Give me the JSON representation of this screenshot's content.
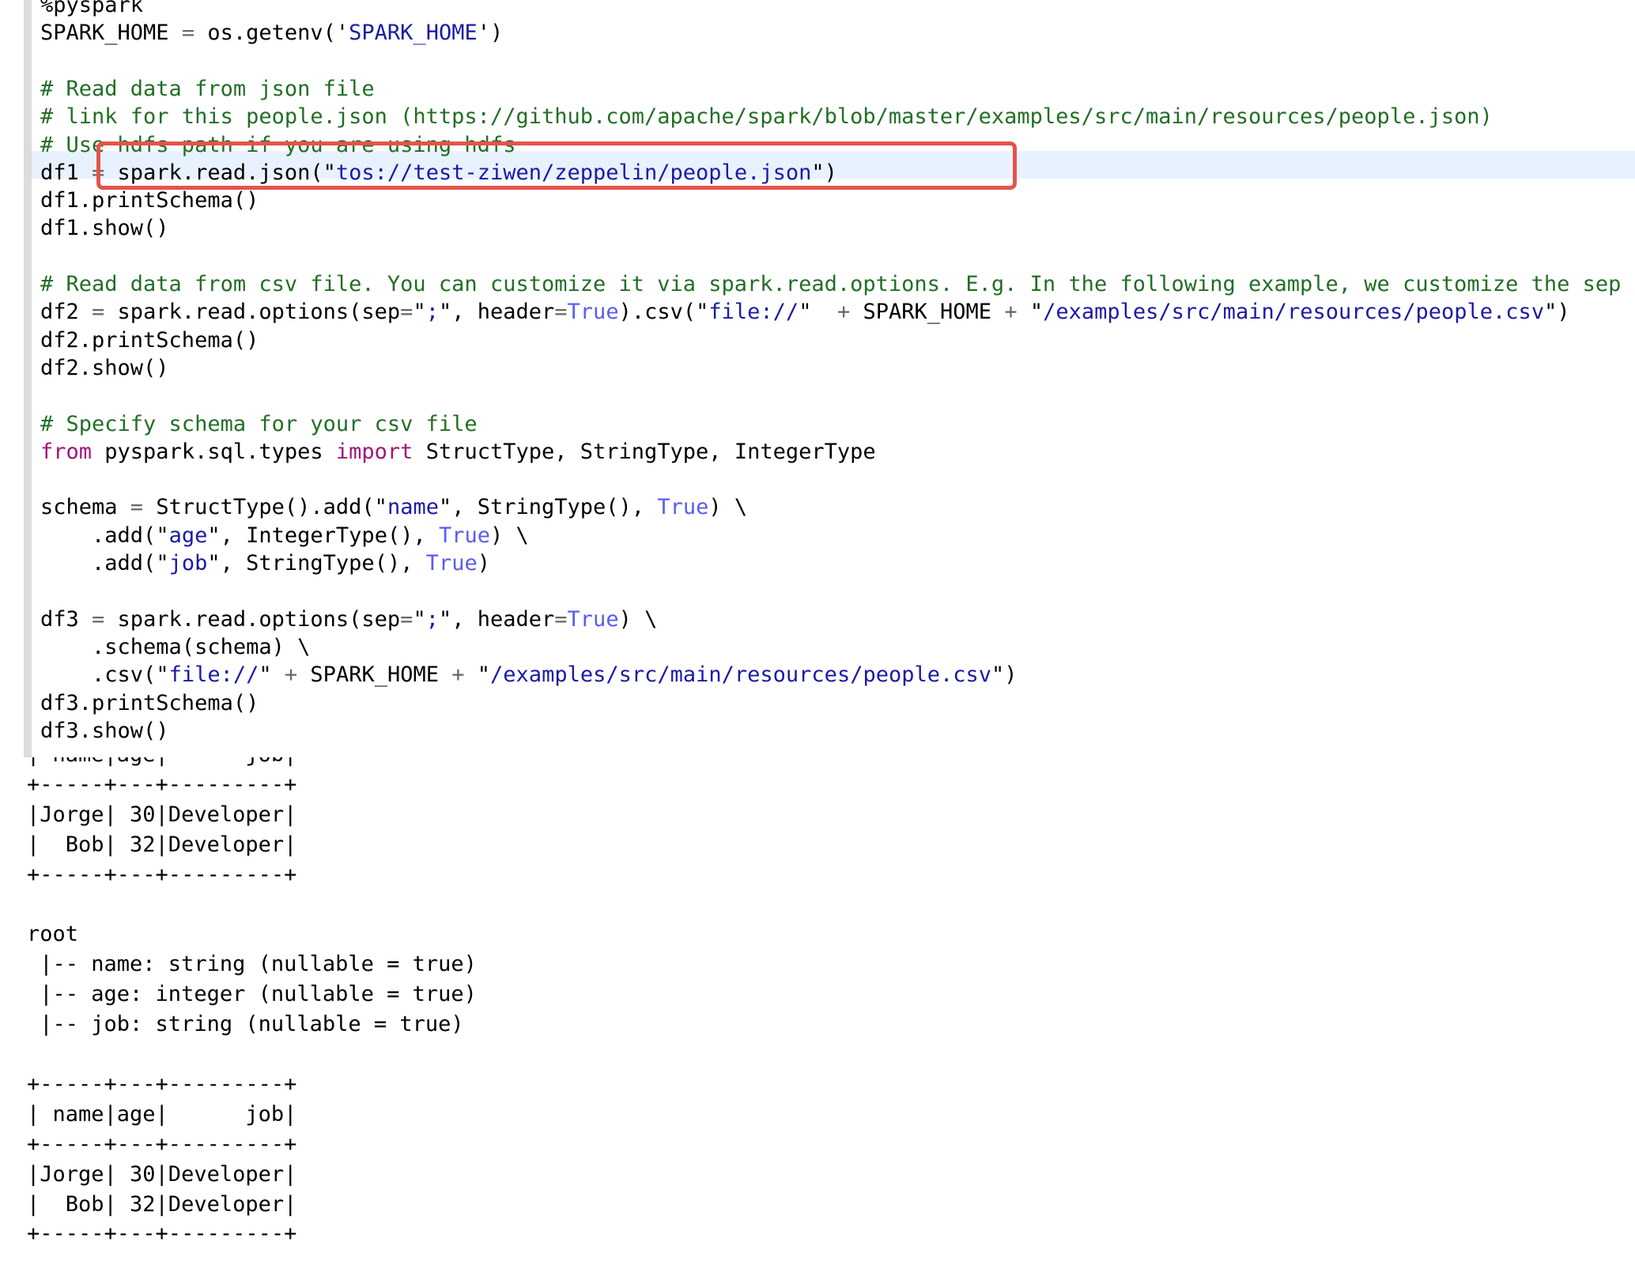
{
  "code_lines": [
    "%pyspark",
    "SPARK_HOME = os.getenv('SPARK_HOME')",
    "",
    "# Read data from json file",
    "# link for this people.json (https://github.com/apache/spark/blob/master/examples/src/main/resources/people.json)",
    "# Use hdfs path if you are using hdfs",
    "df1 = spark.read.json(\"tos://test-ziwen/zeppelin/people.json\")",
    "df1.printSchema()",
    "df1.show()",
    "",
    "# Read data from csv file. You can customize it via spark.read.options. E.g. In the following example, we customize the sep and",
    "df2 = spark.read.options(sep=\";\", header=True).csv(\"file://\"  + SPARK_HOME + \"/examples/src/main/resources/people.csv\")",
    "df2.printSchema()",
    "df2.show()",
    "",
    "# Specify schema for your csv file",
    "from pyspark.sql.types import StructType, StringType, IntegerType",
    "",
    "schema = StructType().add(\"name\", StringType(), True) \\",
    "    .add(\"age\", IntegerType(), True) \\",
    "    .add(\"job\", StringType(), True)",
    "",
    "df3 = spark.read.options(sep=\";\", header=True) \\",
    "    .schema(schema) \\",
    "    .csv(\"file://\" + SPARK_HOME + \"/examples/src/main/resources/people.csv\")",
    "df3.printSchema()",
    "df3.show()"
  ],
  "output_lines": [
    "| name|age|      job|",
    "+-----+---+---------+",
    "|Jorge| 30|Developer|",
    "|  Bob| 32|Developer|",
    "+-----+---+---------+",
    "",
    "root",
    " |-- name: string (nullable = true)",
    " |-- age: integer (nullable = true)",
    " |-- job: string (nullable = true)",
    "",
    "+-----+---+---------+",
    "| name|age|      job|",
    "+-----+---+---------+",
    "|Jorge| 30|Developer|",
    "|  Bob| 32|Developer|",
    "+-----+---+---------+"
  ],
  "colors": {
    "comment": "#236e25",
    "string": "#1a1aa6",
    "keyword": "#a0167a",
    "boolean": "#585cf6",
    "highlight_box": "#e5534b",
    "active_line": "#e8f2ff",
    "gutter": "#dcdcdc"
  }
}
